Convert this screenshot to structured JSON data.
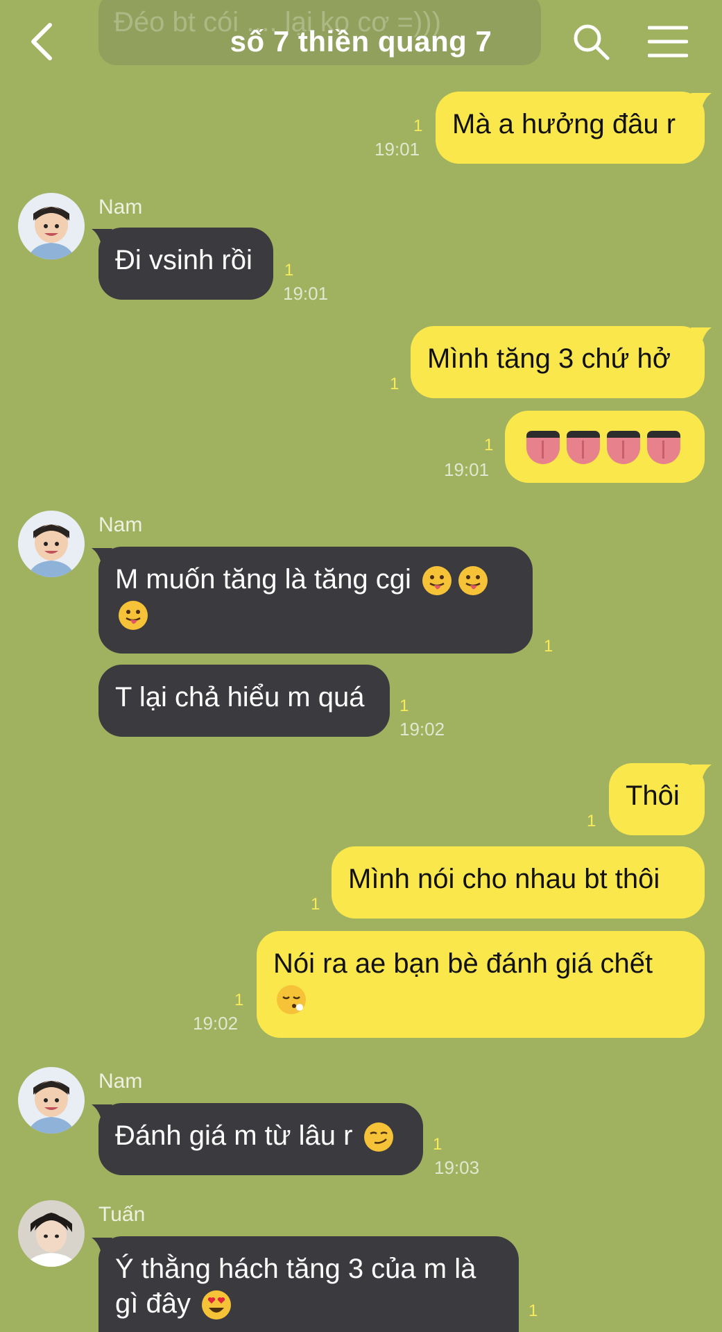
{
  "header": {
    "title": "số 7 thiền quang 7",
    "ghost_text": "Đéo bt cói .... lại ko cơ =)))"
  },
  "messages": {
    "m1": {
      "text": "Mà a hưởng đâu r",
      "read": "1",
      "time": "19:01"
    },
    "m2": {
      "sender": "Nam",
      "text": "Đi vsinh rồi",
      "read": "1",
      "time": "19:01"
    },
    "m3": {
      "text": "Mình tăng 3 chứ hở",
      "read": "1"
    },
    "m4": {
      "read": "1",
      "time": "19:01",
      "emoji": "👅👅👅👅"
    },
    "m5": {
      "sender": "Nam",
      "line1": "M muốn tăng là tăng cgi",
      "emoji": "😛",
      "read": "1"
    },
    "m6": {
      "text": "T lại chả hiểu m quá",
      "read": "1",
      "time": "19:02"
    },
    "m7": {
      "text": "Thôi",
      "read": "1"
    },
    "m8": {
      "text": "Mình nói cho nhau bt thôi",
      "read": "1"
    },
    "m9": {
      "text": "Nói ra ae bạn bè đánh giá chết",
      "emoji": "😮‍💨",
      "read": "1",
      "time": "19:02"
    },
    "m10": {
      "sender": "Nam",
      "text": "Đánh giá m từ lâu r",
      "emoji": "😏",
      "read": "1",
      "time": "19:03"
    },
    "m11": {
      "sender": "Tuấn",
      "line1": "Ý thằng hách tăng 3 của m là",
      "line2": "gì đây",
      "emoji": "😍",
      "read": "1"
    }
  },
  "colors": {
    "background": "#a0b160",
    "my_bubble": "#f9e74c",
    "their_bubble": "#3b3b3f",
    "read_count": "#f7eb5c"
  },
  "icons": [
    "back-icon",
    "search-icon",
    "menu-icon"
  ]
}
